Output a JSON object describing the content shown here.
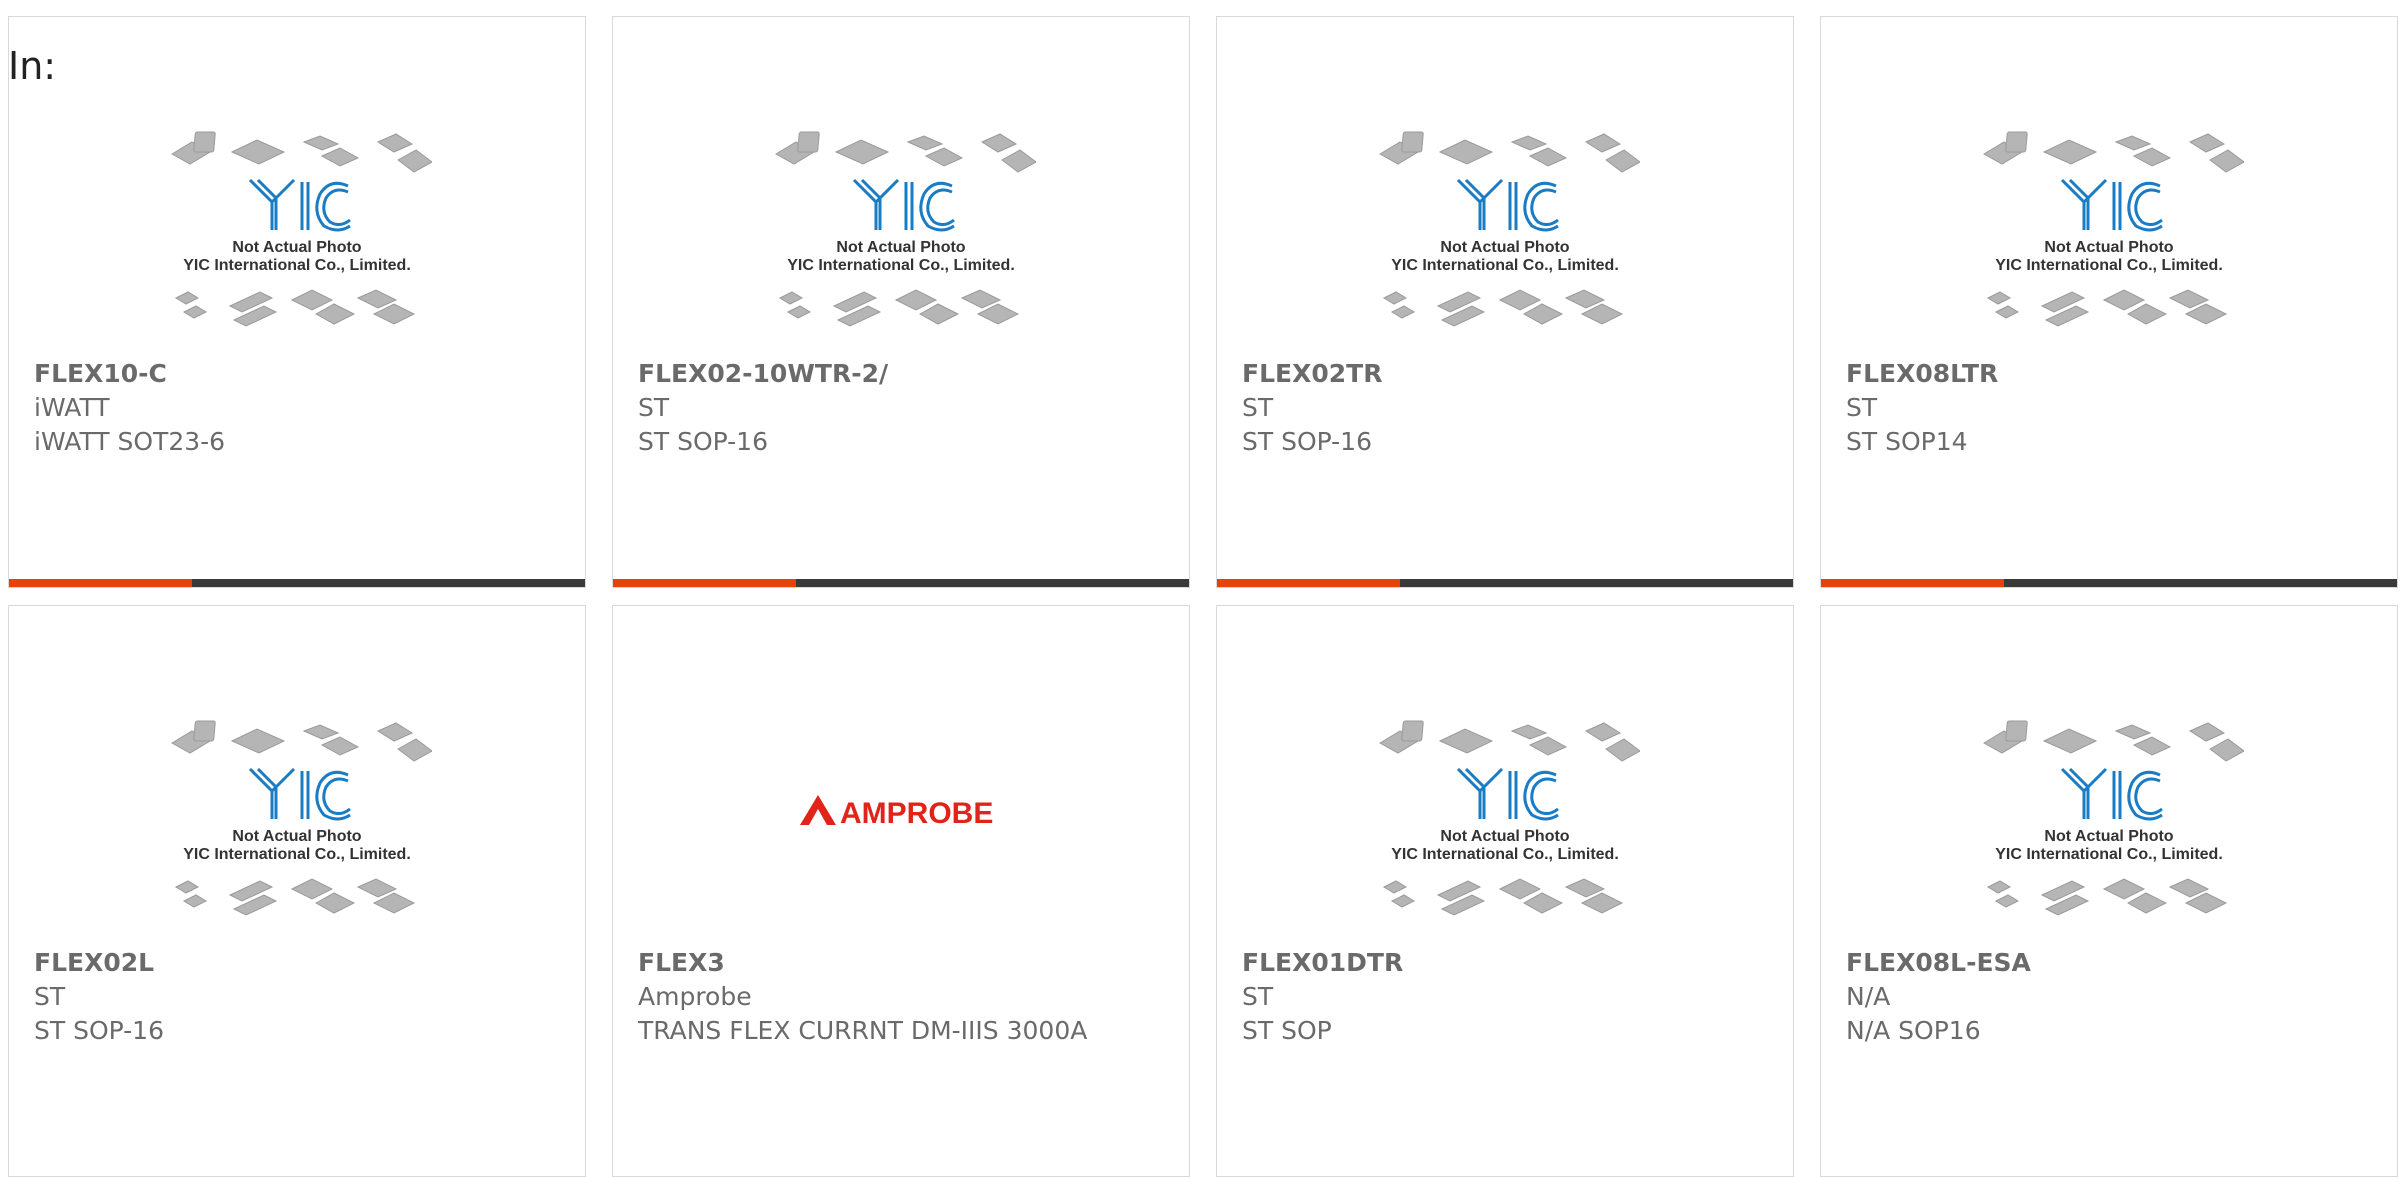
{
  "filter_label": "In:",
  "colors": {
    "accent": "#e8410c",
    "bar": "#3a3a3a",
    "yic_blue": "#1a7cc4",
    "amprobe_red": "#e2231a"
  },
  "placeholder": {
    "line1": "Not Actual Photo",
    "line2": "YIC International Co., Limited.",
    "logo": "YIC"
  },
  "amprobe_logo_text": "AMPROBE",
  "products": [
    {
      "pn": "FLEX10-C",
      "mfr": "iWATT",
      "desc": "iWATT SOT23-6",
      "image": "yic-placeholder"
    },
    {
      "pn": "FLEX02-10WTR-2/",
      "mfr": "ST",
      "desc": "ST SOP-16",
      "image": "yic-placeholder"
    },
    {
      "pn": "FLEX02TR",
      "mfr": "ST",
      "desc": "ST SOP-16",
      "image": "yic-placeholder"
    },
    {
      "pn": "FLEX08LTR",
      "mfr": "ST",
      "desc": "ST SOP14",
      "image": "yic-placeholder"
    },
    {
      "pn": "FLEX02L",
      "mfr": "ST",
      "desc": "ST SOP-16",
      "image": "yic-placeholder"
    },
    {
      "pn": "FLEX3",
      "mfr": "Amprobe",
      "desc": "TRANS FLEX CURRNT DM-IIIS 3000A",
      "image": "amprobe-logo"
    },
    {
      "pn": "FLEX01DTR",
      "mfr": "ST",
      "desc": "ST SOP",
      "image": "yic-placeholder"
    },
    {
      "pn": "FLEX08L-ESA",
      "mfr": "N/A",
      "desc": "N/A SOP16",
      "image": "yic-placeholder"
    }
  ]
}
